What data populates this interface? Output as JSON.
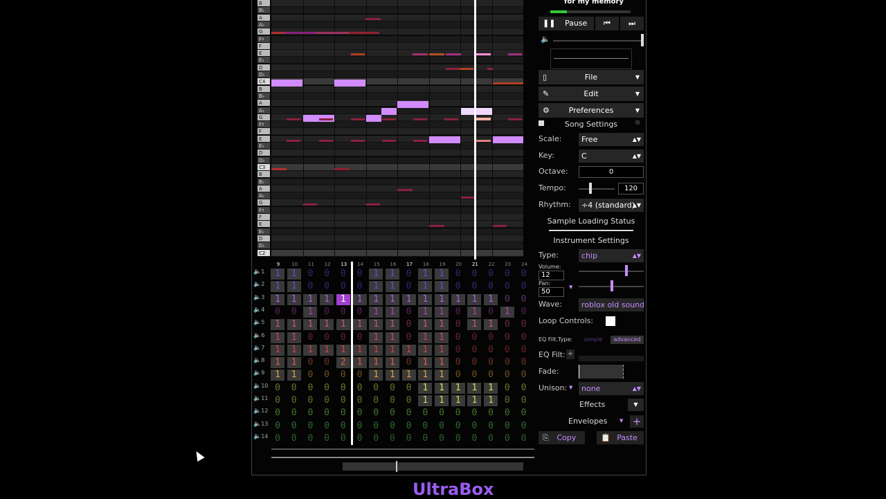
{
  "song": {
    "title": "for my memory"
  },
  "transport": {
    "pause_label": "Pause"
  },
  "menus": {
    "file": "File",
    "edit": "Edit",
    "preferences": "Preferences"
  },
  "song_settings": {
    "heading": "Song Settings",
    "scale_label": "Scale:",
    "scale_value": "Free",
    "key_label": "Key:",
    "key_value": "C",
    "octave_label": "Octave:",
    "octave_value": "0",
    "tempo_label": "Tempo:",
    "tempo_value": "120",
    "rhythm_label": "Rhythm:",
    "rhythm_value": "÷4 (standard)",
    "sample_status": "Sample Loading Status"
  },
  "instrument_settings": {
    "heading": "Instrument Settings",
    "type_label": "Type:",
    "type_value": "chip",
    "volume_label": "Volume:",
    "volume_value": "12",
    "pan_label": "Pan:",
    "pan_value": "50",
    "wave_label": "Wave:",
    "wave_value": "roblox old sound$",
    "loop_label": "Loop Controls:",
    "eq_type_label": "EQ Filt.Type:",
    "eq_simple": "simple",
    "eq_advanced": "advanced",
    "eq_filt_label": "EQ Filt:",
    "fade_label": "Fade:",
    "unison_label": "Unison:",
    "unison_value": "none",
    "effects_label": "Effects",
    "envelopes_label": "Envelopes",
    "copy_label": "Copy",
    "paste_label": "Paste"
  },
  "piano_keys": [
    "B",
    "B♭",
    "A",
    "A♭",
    "G",
    "F♯",
    "F",
    "E",
    "E♭",
    "D",
    "D♭",
    "C4",
    "B",
    "B♭",
    "A",
    "A♭",
    "G",
    "F♯",
    "F",
    "E",
    "E♭",
    "D",
    "D♭",
    "C3",
    "B",
    "B♭",
    "A",
    "A♭",
    "G",
    "F♯",
    "F",
    "E",
    "E♭",
    "D",
    "D♭",
    "C2"
  ],
  "bar_numbers": [
    "9",
    "10",
    "11",
    "12",
    "13",
    "14",
    "15",
    "16",
    "17",
    "18",
    "19",
    "20",
    "21",
    "22",
    "23",
    "24"
  ],
  "channels": [
    "1",
    "2",
    "3",
    "4",
    "5",
    "6",
    "7",
    "8",
    "9",
    "10",
    "11",
    "12",
    "13",
    "14"
  ],
  "pattern_grid": [
    [
      "1",
      "1",
      "0",
      "0",
      "0",
      "0",
      "1",
      "1",
      "0",
      "1",
      "1",
      "0",
      "0",
      "0",
      "0",
      "0"
    ],
    [
      "1",
      "1",
      "0",
      "0",
      "0",
      "0",
      "1",
      "1",
      "0",
      "1",
      "1",
      "0",
      "0",
      "0",
      "0",
      "0"
    ],
    [
      "1",
      "1",
      "1",
      "1",
      "1",
      "1",
      "1",
      "1",
      "1",
      "1",
      "1",
      "1",
      "1",
      "1",
      "0",
      "0"
    ],
    [
      "0",
      "0",
      "1",
      "0",
      "0",
      "0",
      "1",
      "1",
      "0",
      "1",
      "1",
      "0",
      "1",
      "0",
      "1",
      "0"
    ],
    [
      "1",
      "1",
      "1",
      "1",
      "1",
      "1",
      "1",
      "1",
      "0",
      "1",
      "1",
      "0",
      "1",
      "1",
      "0",
      "0"
    ],
    [
      "1",
      "1",
      "0",
      "0",
      "0",
      "0",
      "1",
      "1",
      "0",
      "1",
      "1",
      "0",
      "0",
      "0",
      "0",
      "0"
    ],
    [
      "1",
      "1",
      "1",
      "1",
      "1",
      "1",
      "1",
      "1",
      "1",
      "1",
      "1",
      "0",
      "0",
      "0",
      "0",
      "0"
    ],
    [
      "1",
      "1",
      "0",
      "0",
      "2",
      "1",
      "1",
      "1",
      "0",
      "1",
      "1",
      "0",
      "0",
      "0",
      "0",
      "0"
    ],
    [
      "1",
      "1",
      "0",
      "0",
      "0",
      "0",
      "1",
      "1",
      "1",
      "1",
      "1",
      "0",
      "0",
      "0",
      "0",
      "0"
    ],
    [
      "0",
      "0",
      "0",
      "0",
      "0",
      "0",
      "0",
      "0",
      "0",
      "1",
      "1",
      "1",
      "1",
      "1",
      "0",
      "0"
    ],
    [
      "0",
      "0",
      "0",
      "0",
      "0",
      "0",
      "0",
      "0",
      "0",
      "1",
      "1",
      "1",
      "1",
      "1",
      "0",
      "0"
    ],
    [
      "0",
      "0",
      "0",
      "0",
      "0",
      "0",
      "0",
      "0",
      "0",
      "0",
      "0",
      "0",
      "0",
      "0",
      "0",
      "0"
    ],
    [
      "0",
      "0",
      "0",
      "0",
      "0",
      "0",
      "0",
      "0",
      "0",
      "0",
      "0",
      "0",
      "0",
      "0",
      "0",
      "0"
    ],
    [
      "0",
      "0",
      "0",
      "0",
      "0",
      "0",
      "0",
      "0",
      "0",
      "0",
      "0",
      "0",
      "0",
      "0",
      "0",
      "0"
    ]
  ],
  "channel_colors": [
    "#5a50d8",
    "#5a50d8",
    "#b060e0",
    "#b040b0",
    "#d05080",
    "#d04070",
    "#d04050",
    "#e06040",
    "#e0a040",
    "#d8e050",
    "#b8e050",
    "#80e060",
    "#60d060",
    "#50c050"
  ],
  "colors": {
    "accent": "#9a5cf0",
    "note_main": "#d18cff",
    "note_dim": "#8a2040"
  },
  "brand": "UltraBox"
}
